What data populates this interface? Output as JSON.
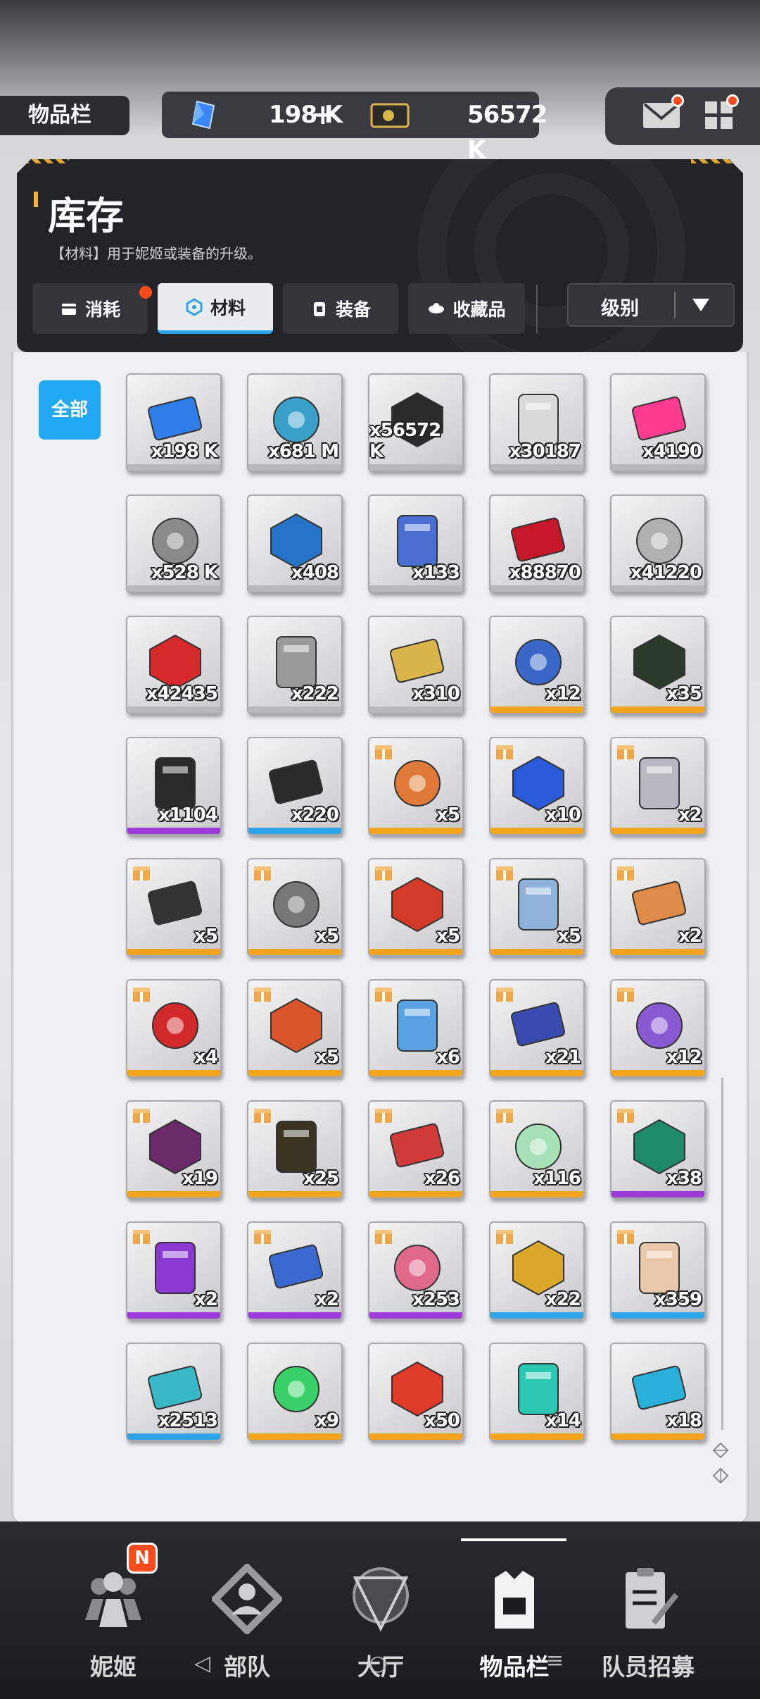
{
  "header": {
    "title_tab": "物品栏",
    "gems": "198 K",
    "gems_add": "+",
    "credits": "56572 K"
  },
  "panel": {
    "title": "库存",
    "description": "【材料】用于妮姬或装备的升级。",
    "tabs": [
      {
        "label": "消耗",
        "icon": "consumable-icon"
      },
      {
        "label": "材料",
        "icon": "material-icon"
      },
      {
        "label": "装备",
        "icon": "equipment-icon"
      },
      {
        "label": "收藏品",
        "icon": "collectible-icon"
      }
    ],
    "active_tab": "材料",
    "sort_label": "级别"
  },
  "filter": {
    "all": "全部"
  },
  "items": [
    {
      "name": "gem-crystal",
      "count": "x198 K",
      "rarity": "none",
      "color": "#2f7de8",
      "gift": false
    },
    {
      "name": "usb-drive",
      "count": "x681 M",
      "rarity": "none",
      "color": "#3aa0c8",
      "gift": false
    },
    {
      "name": "credit-card",
      "count": "x56572 K",
      "rarity": "none",
      "color": "#2b2b2b",
      "gift": false
    },
    {
      "name": "robot-core",
      "count": "x30187",
      "rarity": "none",
      "color": "#d9d9d9",
      "gift": false
    },
    {
      "name": "pink-heart",
      "count": "x4190",
      "rarity": "none",
      "color": "#ff3b8d",
      "gift": false
    },
    {
      "name": "ticket-stub",
      "count": "x528 K",
      "rarity": "none",
      "color": "#8a8a8a",
      "gift": false
    },
    {
      "name": "blue-card",
      "count": "x408",
      "rarity": "none",
      "color": "#2673c7",
      "gift": false
    },
    {
      "name": "holo-card",
      "count": "x133",
      "rarity": "none",
      "color": "#4a6fd0",
      "gift": false
    },
    {
      "name": "red-orb",
      "count": "x88870",
      "rarity": "none",
      "color": "#c7182a",
      "gift": false
    },
    {
      "name": "dna-hex",
      "count": "x41220",
      "rarity": "none",
      "color": "#b0b0b0",
      "gift": false
    },
    {
      "name": "red-chip",
      "count": "x42435",
      "rarity": "none",
      "color": "#d42a2a",
      "gift": false
    },
    {
      "name": "wing-card",
      "count": "x222",
      "rarity": "none",
      "color": "#9a9a9a",
      "gift": false
    },
    {
      "name": "gold-card",
      "count": "x310",
      "rarity": "none",
      "color": "#d8b44a",
      "gift": false
    },
    {
      "name": "id-badge",
      "count": "x12",
      "rarity": "gold",
      "color": "#3b68c8",
      "gift": false
    },
    {
      "name": "circuit-board",
      "count": "x35",
      "rarity": "gold",
      "color": "#2b3a2b",
      "gift": false
    },
    {
      "name": "black-module",
      "count": "x1104",
      "rarity": "purple",
      "color": "#2a2a2a",
      "gift": false
    },
    {
      "name": "black-module-2",
      "count": "x220",
      "rarity": "blue",
      "color": "#2a2a2a",
      "gift": false
    },
    {
      "name": "fox-plush",
      "count": "x5",
      "rarity": "gold",
      "color": "#e07a3a",
      "gift": true
    },
    {
      "name": "gamepad",
      "count": "x10",
      "rarity": "gold",
      "color": "#2c5ad6",
      "gift": true
    },
    {
      "name": "statue",
      "count": "x2",
      "rarity": "gold",
      "color": "#b8b8c0",
      "gift": true
    },
    {
      "name": "fountain-pen",
      "count": "x5",
      "rarity": "gold",
      "color": "#333333",
      "gift": true
    },
    {
      "name": "card-frame",
      "count": "x5",
      "rarity": "gold",
      "color": "#777777",
      "gift": true
    },
    {
      "name": "dog-bowl",
      "count": "x5",
      "rarity": "gold",
      "color": "#d23a2a",
      "gift": true
    },
    {
      "name": "star-plush",
      "count": "x5",
      "rarity": "gold",
      "color": "#8fb0d8",
      "gift": true
    },
    {
      "name": "lipstick",
      "count": "x2",
      "rarity": "gold",
      "color": "#e08a4a",
      "gift": true
    },
    {
      "name": "remote-button",
      "count": "x4",
      "rarity": "gold",
      "color": "#d12a2a",
      "gift": true
    },
    {
      "name": "toy-train",
      "count": "x5",
      "rarity": "gold",
      "color": "#d8542a",
      "gift": true
    },
    {
      "name": "water-bottles",
      "count": "x6",
      "rarity": "gold",
      "color": "#5aa2e0",
      "gift": true
    },
    {
      "name": "year-ticket",
      "count": "x21",
      "rarity": "gold",
      "color": "#3a4bb0",
      "gift": true
    },
    {
      "name": "purple-ticket",
      "count": "x12",
      "rarity": "gold",
      "color": "#8a5ad0",
      "gift": true
    },
    {
      "name": "vip-beauty-card",
      "count": "x19",
      "rarity": "gold",
      "color": "#6a2a6a",
      "gift": true
    },
    {
      "name": "vip-gold-card",
      "count": "x25",
      "rarity": "gold",
      "color": "#3a3320",
      "gift": true
    },
    {
      "name": "red-coupon",
      "count": "x26",
      "rarity": "gold",
      "color": "#d03a3a",
      "gift": true
    },
    {
      "name": "green-coupon",
      "count": "x116",
      "rarity": "gold",
      "color": "#a8e0b8",
      "gift": true
    },
    {
      "name": "week-ticket",
      "count": "x38",
      "rarity": "purple",
      "color": "#1f8a6a",
      "gift": true
    },
    {
      "name": "hair-shop-card",
      "count": "x2",
      "rarity": "purple",
      "color": "#8a3ad0",
      "gift": true
    },
    {
      "name": "blue-pass",
      "count": "x2",
      "rarity": "purple",
      "color": "#3a6ad0",
      "gift": true
    },
    {
      "name": "pink-coupon",
      "count": "x253",
      "rarity": "purple",
      "color": "#e06a8a",
      "gift": true
    },
    {
      "name": "day-ticket",
      "count": "x22",
      "rarity": "blue",
      "color": "#d8a82a",
      "gift": true
    },
    {
      "name": "cream-coupon",
      "count": "x359",
      "rarity": "blue",
      "color": "#e8c8a8",
      "gift": true
    },
    {
      "name": "hex-core",
      "count": "x2513",
      "rarity": "blue",
      "color": "#3ab8c8",
      "gift": false
    },
    {
      "name": "green-canister",
      "count": "x9",
      "rarity": "gold",
      "color": "#3ad06a",
      "gift": false
    },
    {
      "name": "red-canister",
      "count": "x50",
      "rarity": "gold",
      "color": "#e03a2a",
      "gift": false
    },
    {
      "name": "teal-canister",
      "count": "x14",
      "rarity": "gold",
      "color": "#2ac8b0",
      "gift": false
    },
    {
      "name": "cyan-canister",
      "count": "x18",
      "rarity": "gold",
      "color": "#2ab0d8",
      "gift": false
    }
  ],
  "rarity_colors": {
    "none": "#b9b9bd",
    "gold": "#f2a51c",
    "purple": "#9b3ad6",
    "blue": "#2ea3e6"
  },
  "bottom_nav": [
    {
      "label": "妮姬",
      "icon": "nikke-icon"
    },
    {
      "label": "部队",
      "icon": "squad-icon"
    },
    {
      "label": "大厅",
      "icon": "lobby-icon"
    },
    {
      "label": "物品栏",
      "icon": "inventory-icon"
    },
    {
      "label": "队员招募",
      "icon": "recruit-icon"
    }
  ],
  "nav_badge": "N",
  "accent_color": "#22a7f2"
}
